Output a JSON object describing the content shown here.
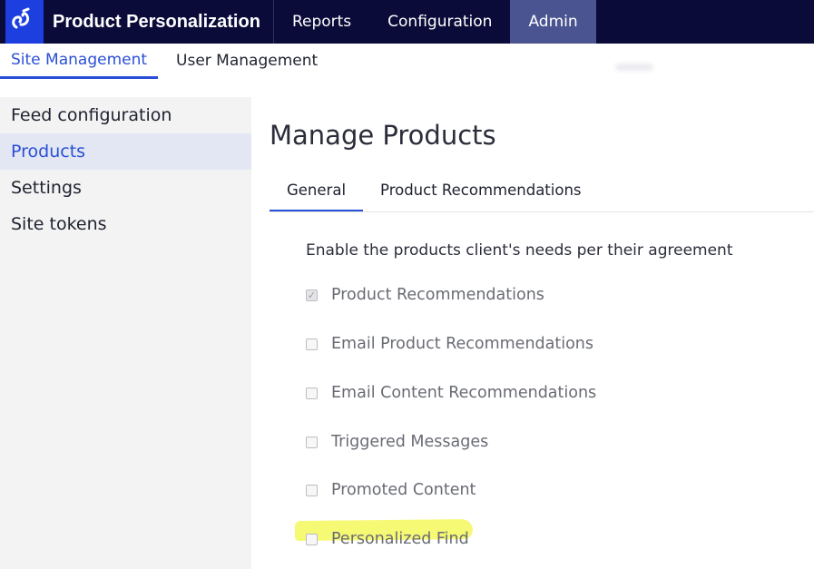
{
  "topbar": {
    "logo_icon": "link-chain-logo-icon",
    "app_title": "Product Personalization",
    "nav": [
      {
        "label": "Reports"
      },
      {
        "label": "Configuration"
      },
      {
        "label": "Admin",
        "active": true
      }
    ]
  },
  "subnav": {
    "items": [
      {
        "label": "Site Management",
        "active": true
      },
      {
        "label": "User Management"
      }
    ]
  },
  "sidebar": {
    "items": [
      {
        "label": "Feed configuration"
      },
      {
        "label": "Products",
        "active": true
      },
      {
        "label": "Settings"
      },
      {
        "label": "Site tokens"
      }
    ]
  },
  "main": {
    "title": "Manage Products",
    "tabs": [
      {
        "label": "General",
        "active": true
      },
      {
        "label": "Product Recommendations"
      }
    ],
    "intro": "Enable the products client's needs per their agreement",
    "options": [
      {
        "label": "Product Recommendations",
        "checked": true
      },
      {
        "label": "Email Product Recommendations",
        "checked": false
      },
      {
        "label": "Email Content Recommendations",
        "checked": false
      },
      {
        "label": "Triggered Messages",
        "checked": false
      },
      {
        "label": "Promoted Content",
        "checked": false
      },
      {
        "label": "Personalized Find",
        "checked": false,
        "highlighted": true
      }
    ]
  },
  "colors": {
    "topbar_bg": "#0b0b3a",
    "logo_bg": "#1e3fe0",
    "active_nav_bg": "#4a5490",
    "accent": "#2a4fd6",
    "sidebar_bg": "#f3f3f3",
    "sidebar_active_bg": "#e3e7f3",
    "highlight": "#f4f85c"
  }
}
